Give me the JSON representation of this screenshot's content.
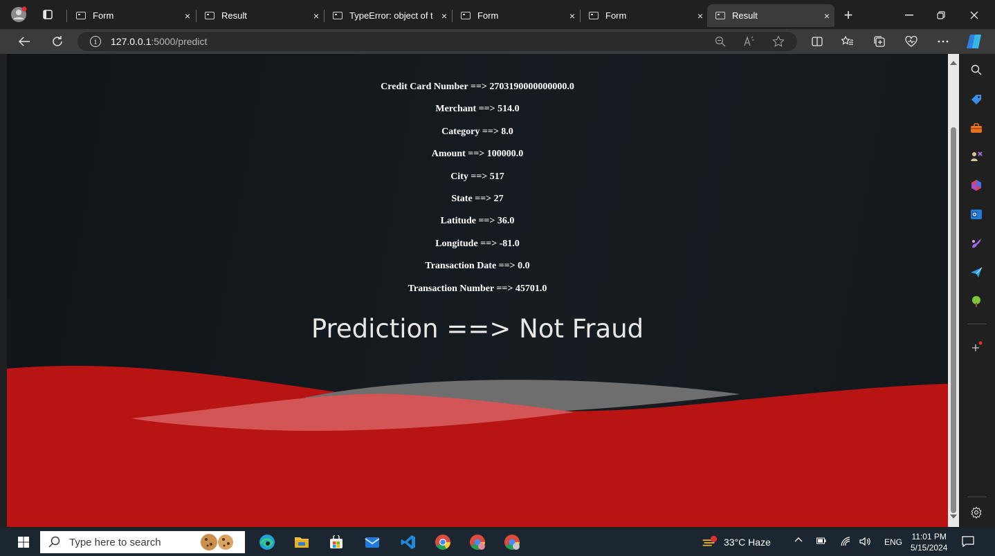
{
  "browser": {
    "tabs": [
      {
        "label": "Form",
        "active": false
      },
      {
        "label": "Result",
        "active": false
      },
      {
        "label": "TypeError: object of t",
        "active": false
      },
      {
        "label": "Form",
        "active": false
      },
      {
        "label": "Form",
        "active": false
      },
      {
        "label": "Result",
        "active": true
      }
    ],
    "close_glyph": "×",
    "new_tab_glyph": "+",
    "url_host": "127.0.0.1",
    "url_path": ":5000/predict",
    "info_glyph": "i"
  },
  "page": {
    "fields": [
      "Credit Card Number ==> 2703190000000000.0",
      "Merchant ==> 514.0",
      "Category ==> 8.0",
      "Amount ==> 100000.0",
      "City ==> 517",
      "State ==> 27",
      "Latitude ==> 36.0",
      "Longitude ==> -81.0",
      "Transaction Date ==> 0.0",
      "Transaction Number ==> 45701.0"
    ],
    "prediction": "Prediction ==> Not Fraud"
  },
  "taskbar": {
    "search_placeholder": "Type here to search",
    "weather": "33°C  Haze",
    "language": "ENG",
    "time": "11:01 PM",
    "date": "5/15/2024"
  },
  "colors": {
    "page_bg": "#13181c",
    "wave_red": "#b81414",
    "wave_grey": "#6e6e6e",
    "wave_pink": "#d45555"
  }
}
